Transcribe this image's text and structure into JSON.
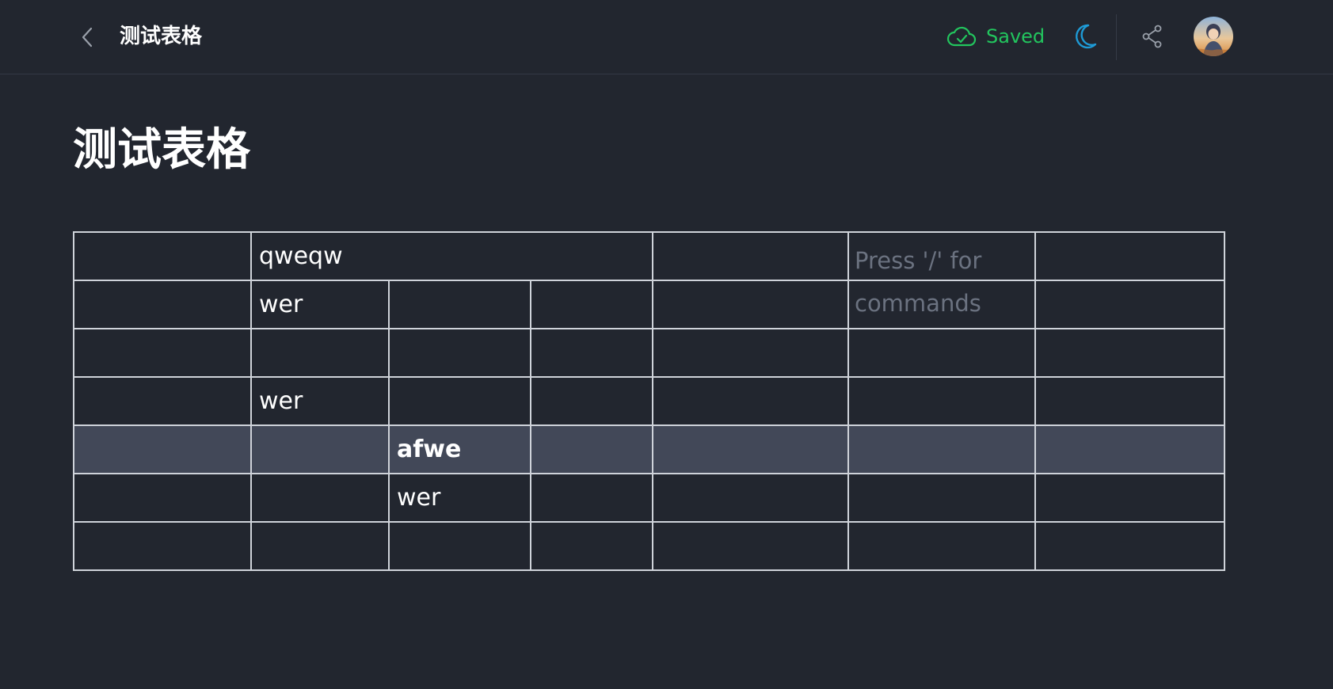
{
  "header": {
    "back_icon": "chevron-left-icon",
    "title": "测试表格",
    "save_status": {
      "icon": "cloud-check-icon",
      "label": "Saved",
      "color": "#22c55e"
    },
    "theme_toggle_icon": "moon-icon",
    "share_icon": "share-icon",
    "avatar_icon": "user-avatar"
  },
  "document": {
    "title": "测试表格",
    "editor_placeholder": "Press '/' for commands"
  },
  "table": {
    "rows": [
      [
        "",
        "qweqw",
        "",
        "",
        "",
        ""
      ],
      [
        "",
        "wer",
        "",
        "",
        "",
        "",
        ""
      ],
      [
        "",
        "",
        "",
        "",
        "",
        "",
        ""
      ],
      [
        "",
        "wer",
        "",
        "",
        "",
        "",
        ""
      ],
      [
        "",
        "",
        "afwe",
        "",
        "",
        "",
        ""
      ],
      [
        "",
        "",
        "wer",
        "",
        "",
        "",
        ""
      ],
      [
        "",
        "",
        "",
        "",
        "",
        "",
        ""
      ]
    ],
    "selected_row": 4
  },
  "colors": {
    "background": "#22262f",
    "border": "#cfd3da",
    "selected_row": "#424858",
    "accent_blue": "#1e9bd7"
  }
}
